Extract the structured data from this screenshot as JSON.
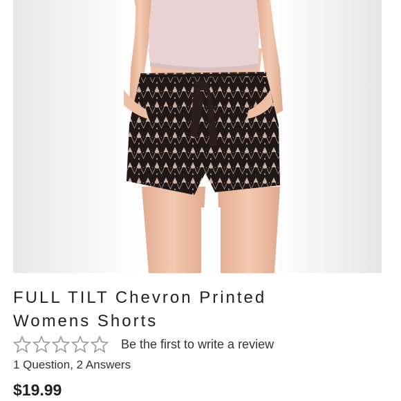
{
  "product": {
    "title_line1": "FULL TILT Chevron Printed",
    "title_line2": "Womens Shorts",
    "rating": 0,
    "rating_max": 5,
    "review_link": "Be the first to write a review",
    "qa_link": "1 Question, 2 Answers",
    "price": "$19.99",
    "image_icon": "product-photo"
  },
  "colors": {
    "text": "#222222",
    "star_outline": "#9a9a9a",
    "top": "#e9d2d4",
    "skin": "#f0c3a8",
    "shorts_dark": "#1f1715",
    "shorts_light": "#c9b1a5"
  }
}
